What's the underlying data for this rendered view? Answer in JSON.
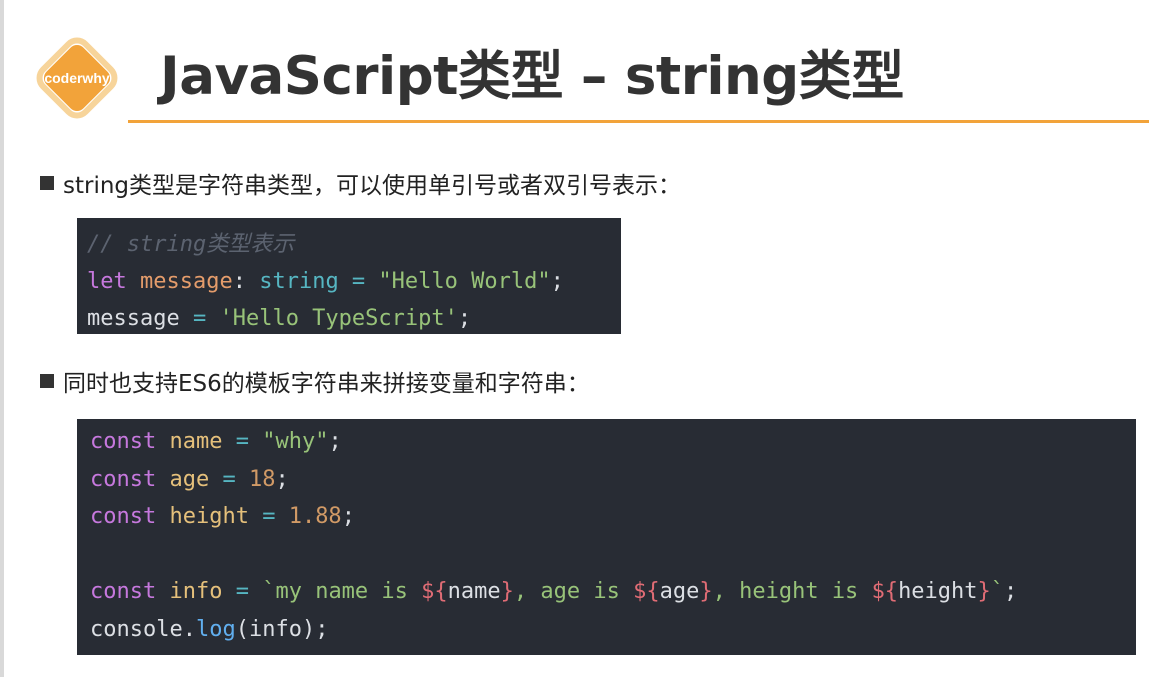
{
  "header": {
    "logo_text": "coderwhy",
    "title": "JavaScript类型 – string类型"
  },
  "colors": {
    "accent": "#f2a33a",
    "code_background": "#282c34"
  },
  "bullets": [
    {
      "text": "string类型是字符串类型，可以使用单引号或者双引号表示："
    },
    {
      "text": "同时也支持ES6的模板字符串来拼接变量和字符串："
    }
  ],
  "code_blocks": [
    {
      "lines": [
        [
          {
            "t": "// string类型表示",
            "c": "t-comment"
          }
        ],
        [
          {
            "t": "let",
            "c": "t-kw"
          },
          {
            "t": " message",
            "c": "t-var2"
          },
          {
            "t": ":",
            "c": "t-plain"
          },
          {
            "t": " string",
            "c": "t-type"
          },
          {
            "t": " =",
            "c": "t-op"
          },
          {
            "t": " \"Hello World\"",
            "c": "t-str"
          },
          {
            "t": ";",
            "c": "t-plain"
          }
        ],
        [
          {
            "t": "message",
            "c": "t-plain"
          },
          {
            "t": " =",
            "c": "t-op"
          },
          {
            "t": " 'Hello TypeScript'",
            "c": "t-str"
          },
          {
            "t": ";",
            "c": "t-plain"
          }
        ]
      ]
    },
    {
      "lines": [
        [
          {
            "t": "const",
            "c": "t-kw"
          },
          {
            "t": " name",
            "c": "t-var"
          },
          {
            "t": " =",
            "c": "t-op"
          },
          {
            "t": " \"why\"",
            "c": "t-str"
          },
          {
            "t": ";",
            "c": "t-plain"
          }
        ],
        [
          {
            "t": "const",
            "c": "t-kw"
          },
          {
            "t": " age",
            "c": "t-var"
          },
          {
            "t": " =",
            "c": "t-op"
          },
          {
            "t": " 18",
            "c": "t-num"
          },
          {
            "t": ";",
            "c": "t-plain"
          }
        ],
        [
          {
            "t": "const",
            "c": "t-kw"
          },
          {
            "t": " height",
            "c": "t-var"
          },
          {
            "t": " =",
            "c": "t-op"
          },
          {
            "t": " 1.88",
            "c": "t-num"
          },
          {
            "t": ";",
            "c": "t-plain"
          }
        ],
        [],
        [
          {
            "t": "const",
            "c": "t-kw"
          },
          {
            "t": " info",
            "c": "t-var"
          },
          {
            "t": " =",
            "c": "t-op"
          },
          {
            "t": " `my name is ",
            "c": "t-str"
          },
          {
            "t": "${",
            "c": "t-interp"
          },
          {
            "t": "name",
            "c": "t-plain"
          },
          {
            "t": "}",
            "c": "t-interp"
          },
          {
            "t": ", age is ",
            "c": "t-str"
          },
          {
            "t": "${",
            "c": "t-interp"
          },
          {
            "t": "age",
            "c": "t-plain"
          },
          {
            "t": "}",
            "c": "t-interp"
          },
          {
            "t": ", height is ",
            "c": "t-str"
          },
          {
            "t": "${",
            "c": "t-interp"
          },
          {
            "t": "height",
            "c": "t-plain"
          },
          {
            "t": "}",
            "c": "t-interp"
          },
          {
            "t": "`",
            "c": "t-str"
          },
          {
            "t": ";",
            "c": "t-plain"
          }
        ],
        [
          {
            "t": "console",
            "c": "t-plain"
          },
          {
            "t": ".",
            "c": "t-plain"
          },
          {
            "t": "log",
            "c": "t-fn"
          },
          {
            "t": "(",
            "c": "t-plain"
          },
          {
            "t": "info",
            "c": "t-plain"
          },
          {
            "t": ");",
            "c": "t-plain"
          }
        ]
      ]
    }
  ]
}
